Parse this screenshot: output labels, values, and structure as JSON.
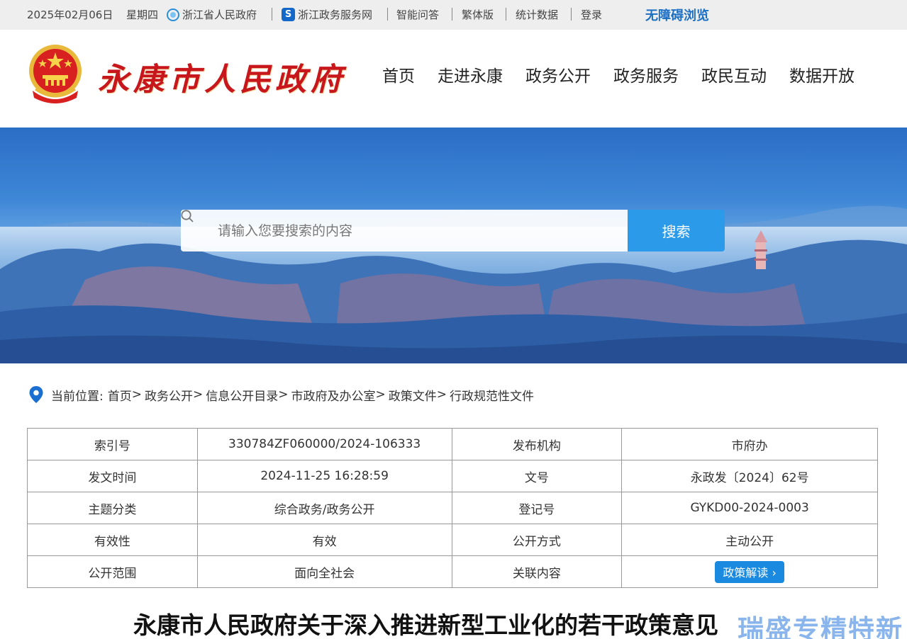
{
  "topbar": {
    "date": "2025年02月06日",
    "weekday": "星期四",
    "links": [
      {
        "label": "浙江省人民政府",
        "icon": "zhejiang-gov-icon"
      },
      {
        "label": "浙江政务服务网",
        "icon": "zhejiang-service-icon"
      },
      {
        "label": "智能问答"
      },
      {
        "label": "繁体版"
      },
      {
        "label": "统计数据"
      },
      {
        "label": "登录"
      }
    ],
    "accessibility": "无障碍浏览"
  },
  "header": {
    "site_title": "永康市人民政府",
    "nav": [
      "首页",
      "走进永康",
      "政务公开",
      "政务服务",
      "政民互动",
      "数据开放"
    ]
  },
  "search": {
    "placeholder": "请输入您要搜索的内容",
    "button": "搜索"
  },
  "breadcrumb": {
    "label": "当前位置:",
    "items": [
      "首页",
      "政务公开",
      "信息公开目录",
      "市政府及办公室",
      "政策文件",
      "行政规范性文件"
    ],
    "separator": ">"
  },
  "info_table": {
    "rows": [
      {
        "k1": "索引号",
        "v1": "330784ZF060000/2024-106333",
        "k2": "发布机构",
        "v2": "市府办"
      },
      {
        "k1": "发文时间",
        "v1": "2024-11-25 16:28:59",
        "k2": "文号",
        "v2": "永政发〔2024〕62号"
      },
      {
        "k1": "主题分类",
        "v1": "综合政务/政务公开",
        "k2": "登记号",
        "v2": "GYKD00-2024-0003"
      },
      {
        "k1": "有效性",
        "v1": "有效",
        "k2": "公开方式",
        "v2": "主动公开"
      },
      {
        "k1": "公开范围",
        "v1": "面向全社会",
        "k2": "关联内容",
        "v2": "政策解读 ›"
      }
    ]
  },
  "document": {
    "title": "永康市人民政府关于深入推进新型工业化的若干政策意见"
  },
  "watermark": "瑞盛专精特新",
  "colors": {
    "gov_red": "#c8161d",
    "accent_blue": "#2b9ae8",
    "a11y_blue": "#1b6fc5"
  }
}
